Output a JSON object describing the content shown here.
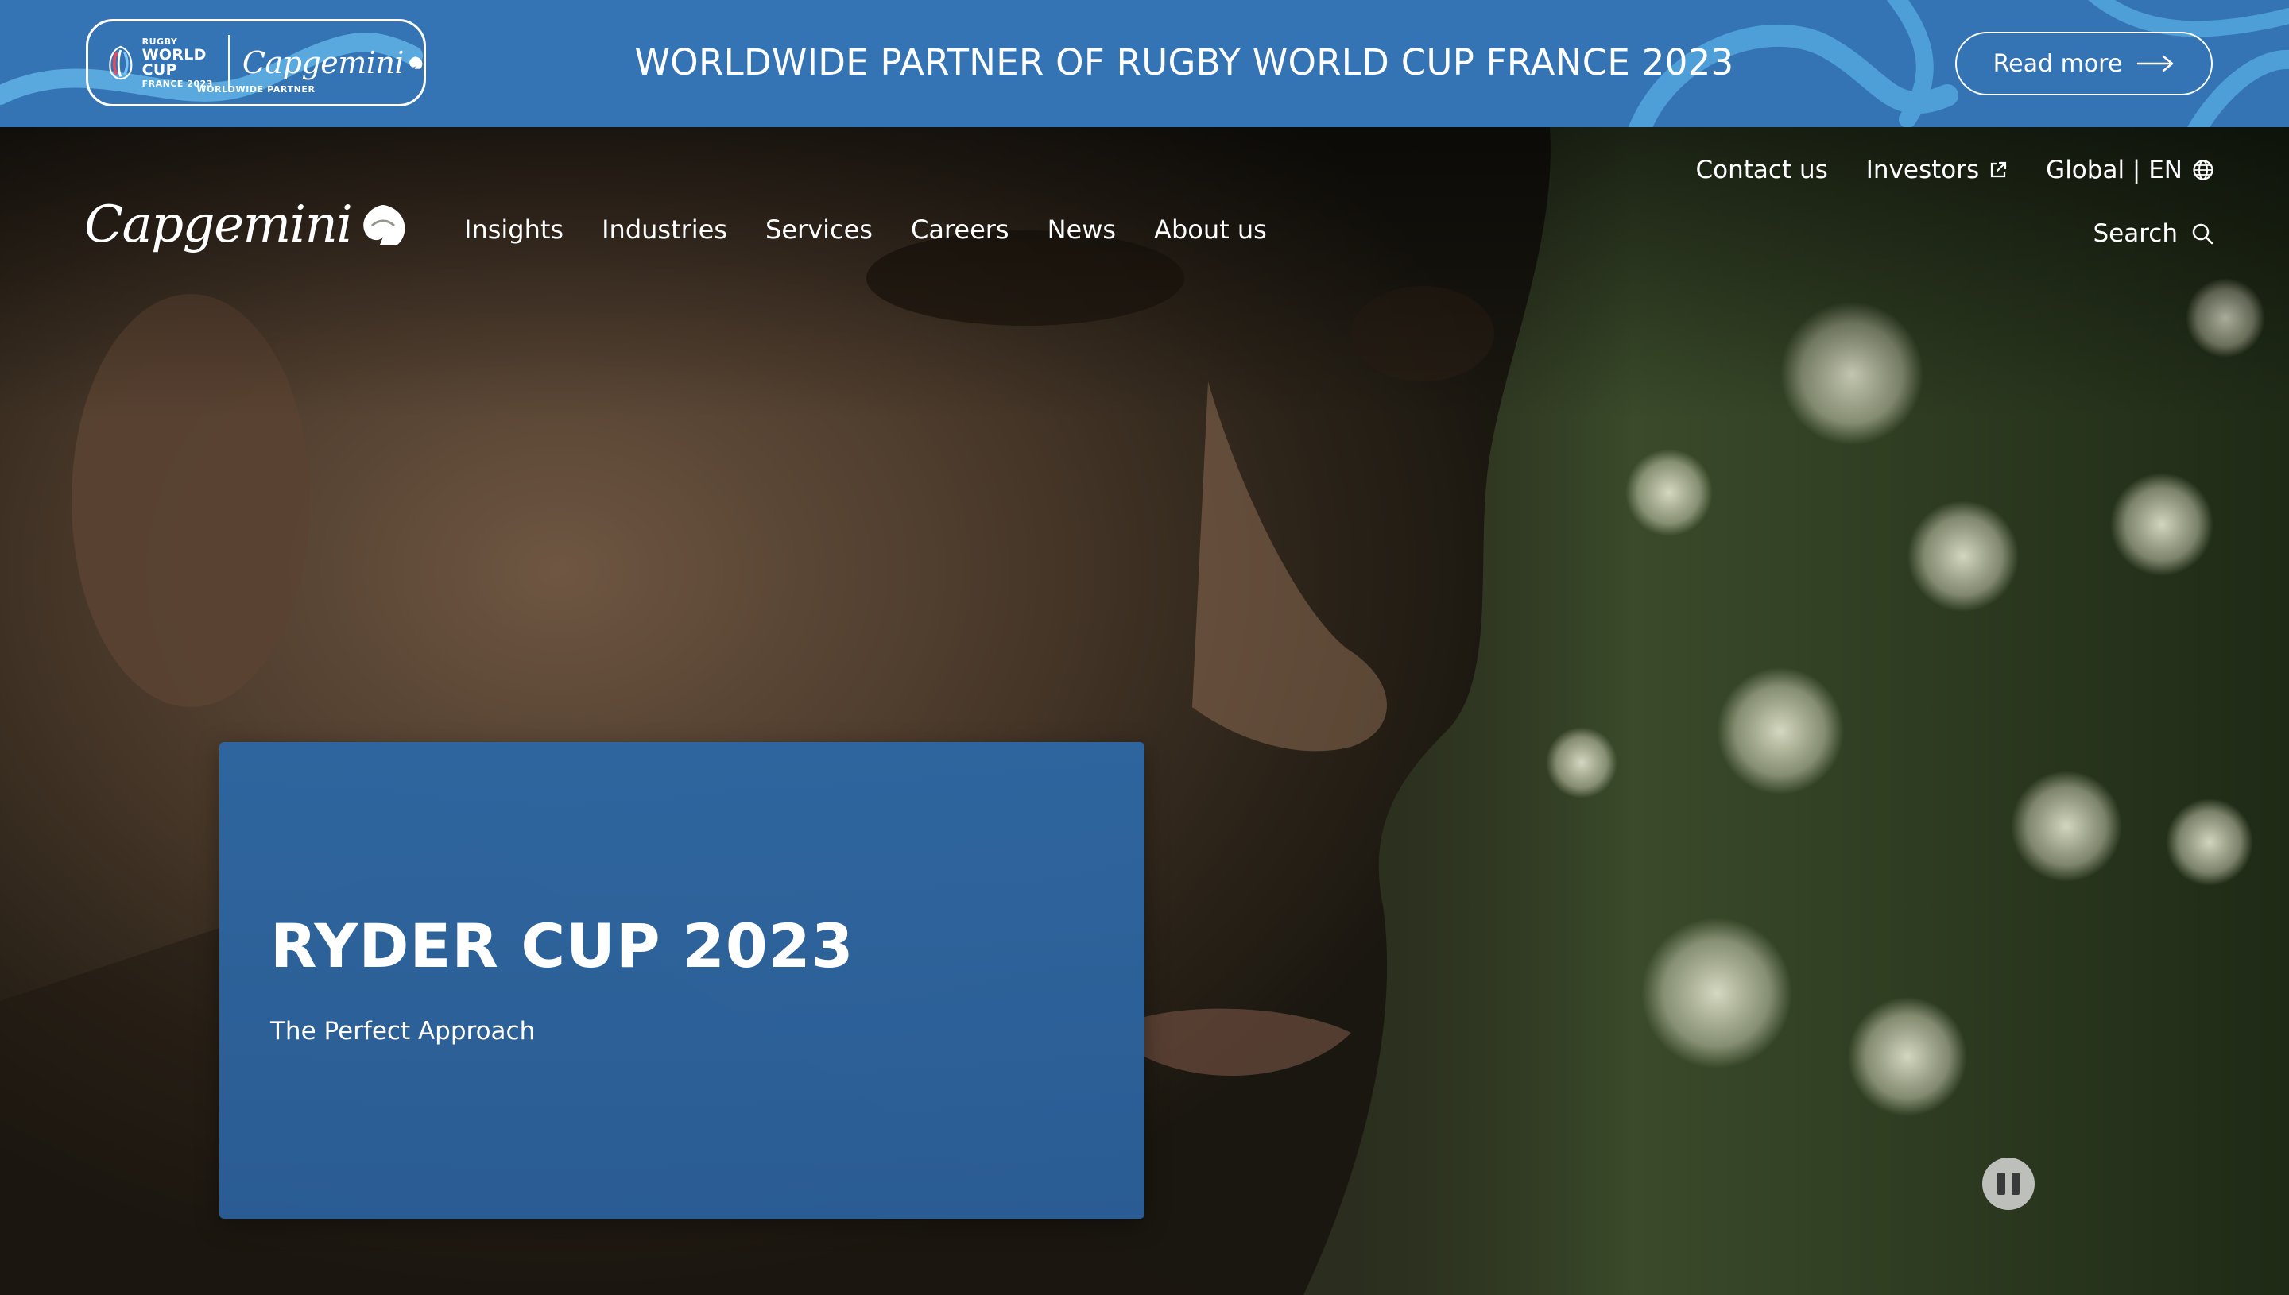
{
  "banner": {
    "badge": {
      "rwc_line1": "RUGBY",
      "rwc_line2": "WORLD CUP",
      "rwc_line3": "FRANCE 2023",
      "brand": "Capgemini",
      "subtitle": "WORLDWIDE PARTNER"
    },
    "title": "WORLDWIDE PARTNER OF RUGBY WORLD CUP FRANCE 2023",
    "read_more": "Read more",
    "read_more_icon": "arrow-right-icon",
    "background_color": "#3474b4"
  },
  "header": {
    "brand": "Capgemini",
    "utility": {
      "contact": "Contact us",
      "investors": "Investors",
      "investors_icon": "external-link-icon",
      "locale": "Global | EN",
      "locale_icon": "globe-icon"
    },
    "search": "Search",
    "search_icon": "search-icon",
    "nav": [
      "Insights",
      "Industries",
      "Services",
      "Careers",
      "News",
      "About us"
    ]
  },
  "hero": {
    "title": "RYDER CUP 2023",
    "subtitle": "The Perfect Approach",
    "card_color": "#2e66a0",
    "pause_icon": "pause-icon"
  }
}
